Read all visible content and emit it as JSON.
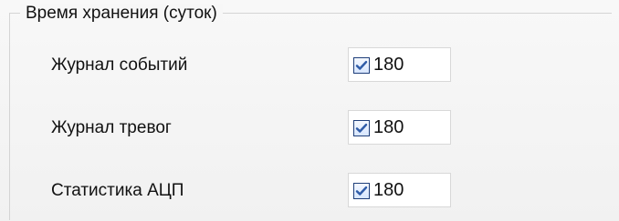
{
  "group": {
    "title": "Время хранения (суток)"
  },
  "settings": [
    {
      "label": "Журнал событий",
      "checked": true,
      "value": "180"
    },
    {
      "label": "Журнал тревог",
      "checked": true,
      "value": "180"
    },
    {
      "label": "Статистика АЦП",
      "checked": true,
      "value": "180"
    }
  ],
  "icons": {
    "checkbox_icon": "checkmark-icon"
  },
  "colors": {
    "checkbox_border": "#1f3f7a",
    "checkbox_check": "#2f5ca8",
    "field_background": "#ffffff"
  }
}
